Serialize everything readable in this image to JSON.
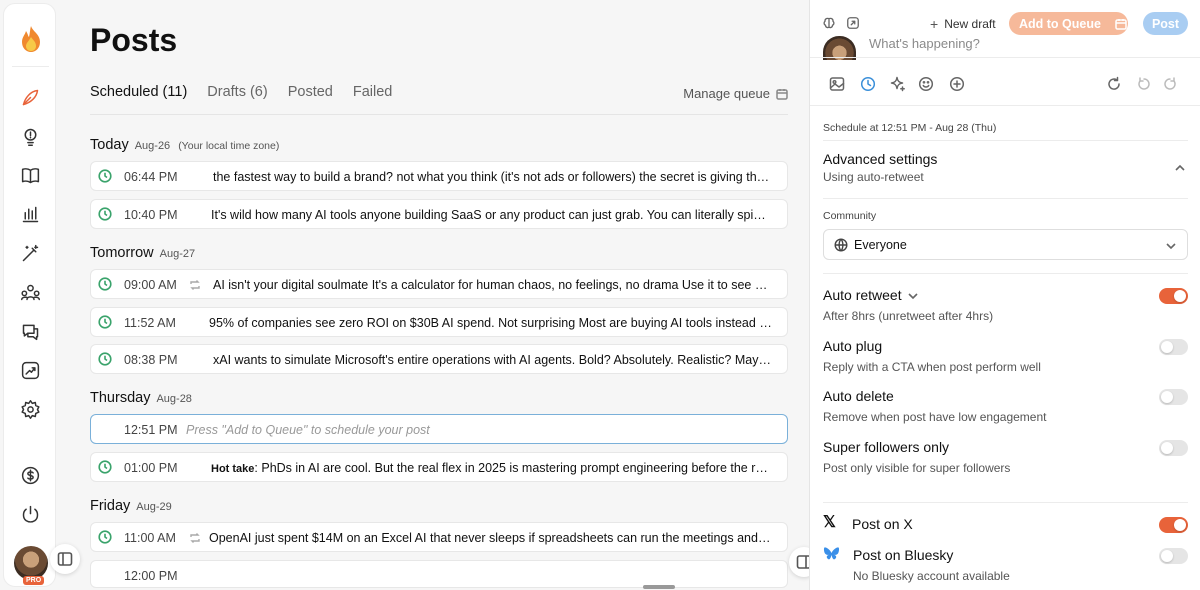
{
  "page": {
    "title": "Posts"
  },
  "tabs": [
    {
      "label": "Scheduled (11)",
      "active": true
    },
    {
      "label": "Drafts (6)"
    },
    {
      "label": "Posted"
    },
    {
      "label": "Failed"
    }
  ],
  "manage_queue": "Manage queue",
  "days": [
    {
      "name": "Today",
      "date": "Aug-26",
      "note": "(Your local time zone)"
    },
    {
      "name": "Tomorrow",
      "date": "Aug-27"
    },
    {
      "name": "Thursday",
      "date": "Aug-28"
    },
    {
      "name": "Friday",
      "date": "Aug-29"
    }
  ],
  "posts": [
    {
      "time": "06:44 PM",
      "text": "the fastest way to build a brand? not what you think (it's not ads or followers) the secret is giving the s..."
    },
    {
      "time": "10:40 PM",
      "text": "It's wild how many AI tools anyone building SaaS or any product can just grab. You can literally spin up ..."
    },
    {
      "time": "09:00 AM",
      "text": "AI isn't your digital soulmate It's a calculator for human chaos, no feelings, no drama Use it to see clea..."
    },
    {
      "time": "11:52 AM",
      "text": "95% of companies see zero ROI on $30B AI spend. Not surprising Most are buying AI tools instead of s..."
    },
    {
      "time": "08:38 PM",
      "text": "xAI wants to simulate Microsoft's entire operations with AI agents. Bold? Absolutely. Realistic? Maybe ..."
    },
    {
      "time": "12:51 PM",
      "placeholder": "Press \"Add to Queue\" to schedule your post"
    },
    {
      "time": "01:00 PM",
      "prefix": "Hot take",
      "text": ": PhDs in AI are cool. But the real flex in 2025 is mastering prompt engineering before the robot..."
    },
    {
      "time": "11:00 AM",
      "text": "OpenAI just spent $14M on an Excel AI that never sleeps if spreadsheets can run the meetings and do t..."
    },
    {
      "time": "12:00 PM",
      "text": ""
    }
  ],
  "composer": {
    "new_draft": "New draft",
    "add_to_queue": "Add to Queue",
    "post": "Post",
    "placeholder": "What's happening?",
    "schedule": "Schedule at 12:51 PM - Aug 28 (Thu)"
  },
  "advanced": {
    "title": "Advanced settings",
    "subtitle": "Using auto-retweet"
  },
  "community": {
    "label": "Community",
    "value": "Everyone"
  },
  "settings": [
    {
      "title": "Auto retweet",
      "subtitle": "After 8hrs (unretweet after 4hrs)",
      "on": true
    },
    {
      "title": "Auto plug",
      "subtitle": "Reply with a CTA when post perform well",
      "on": false
    },
    {
      "title": "Auto delete",
      "subtitle": "Remove when post have low engagement",
      "on": false
    },
    {
      "title": "Super followers only",
      "subtitle": "Post only visible for super followers",
      "on": false
    }
  ],
  "platforms": [
    {
      "title": "Post on X",
      "on": true
    },
    {
      "title": "Post on Bluesky",
      "subtitle": "No Bluesky account available",
      "on": false
    }
  ],
  "badge": "PRO",
  "colors": {
    "accent": "#e8633a",
    "clock": "#3aa36b",
    "post_button": "#a9cdf2"
  }
}
